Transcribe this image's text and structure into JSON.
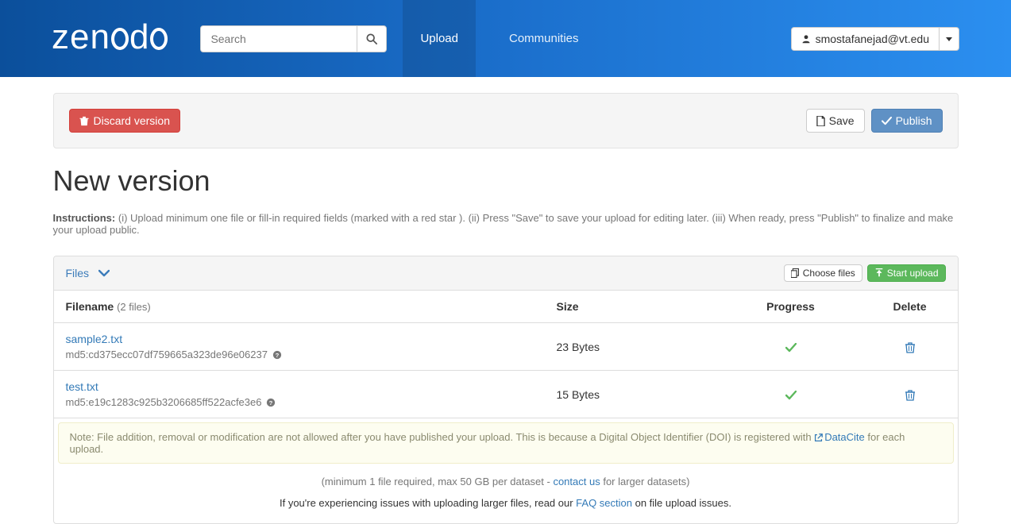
{
  "nav": {
    "logo": "zenodo",
    "search_placeholder": "Search",
    "upload": "Upload",
    "communities": "Communities",
    "user_email": "smostafanejad@vt.edu"
  },
  "actions": {
    "discard": "Discard version",
    "save": "Save",
    "publish": "Publish"
  },
  "page": {
    "title": "New version",
    "instructions_label": "Instructions:",
    "instructions_text": "(i) Upload minimum one file or fill-in required fields (marked with a red star ). (ii) Press \"Save\" to save your upload for editing later. (iii) When ready, press \"Publish\" to finalize and make your upload public."
  },
  "files_panel": {
    "title": "Files",
    "choose_files": "Choose files",
    "start_upload": "Start upload",
    "columns": {
      "filename": "Filename",
      "count": "(2 files)",
      "size": "Size",
      "progress": "Progress",
      "delete": "Delete"
    },
    "rows": [
      {
        "name": "sample2.txt",
        "md5": "md5:cd375ecc07df759665a323de96e06237",
        "size": "23 Bytes"
      },
      {
        "name": "test.txt",
        "md5": "md5:e19c1283c925b3206685ff522acfe3e6",
        "size": "15 Bytes"
      }
    ],
    "note_prefix": "Note: File addition, removal or modification are not allowed after you have published your upload. This is because a Digital Object Identifier (DOI) is registered with ",
    "note_link": "DataCite",
    "note_suffix": " for each upload.",
    "below_prefix": "(minimum 1 file required, max 50 GB per dataset - ",
    "below_link": "contact us",
    "below_suffix": " for larger datasets)",
    "below2_prefix": "If you're experiencing issues with uploading larger files, read our ",
    "below2_link": "FAQ section",
    "below2_suffix": " on file upload issues."
  }
}
